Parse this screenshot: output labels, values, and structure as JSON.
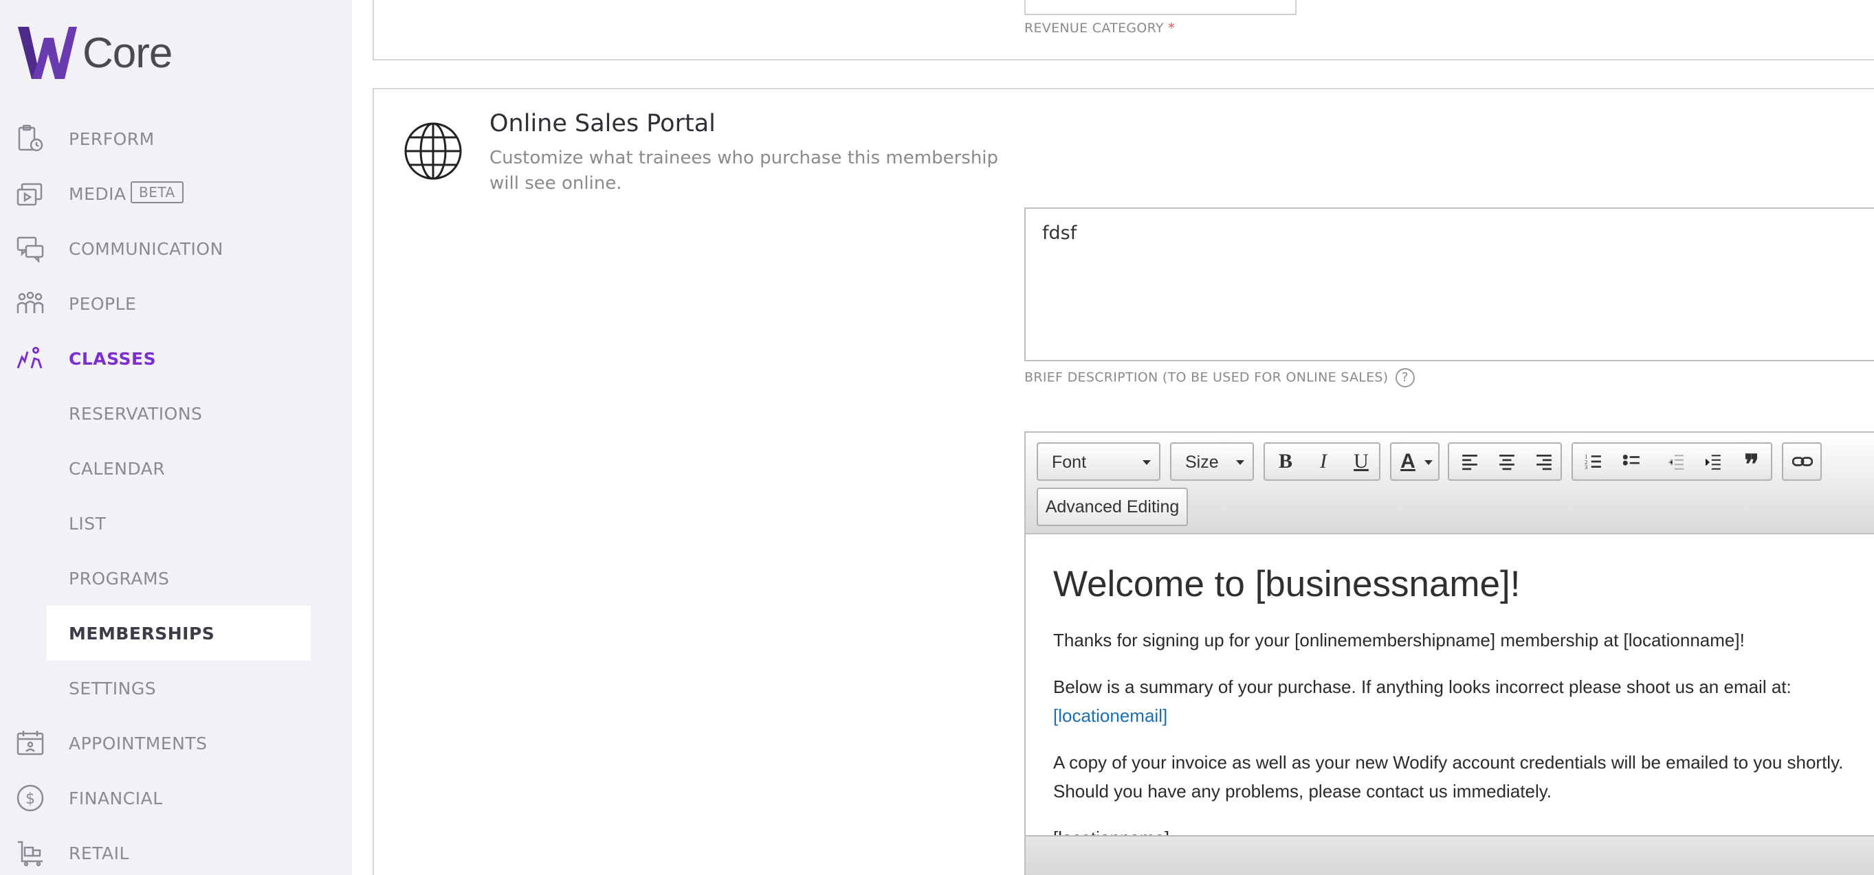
{
  "app": {
    "logo_text": "Core",
    "accent": "#7b2fd1"
  },
  "sidebar": {
    "items": [
      {
        "label": "PERFORM",
        "icon": "perform-icon"
      },
      {
        "label": "MEDIA",
        "icon": "media-icon",
        "badge": "BETA"
      },
      {
        "label": "COMMUNICATION",
        "icon": "communication-icon"
      },
      {
        "label": "PEOPLE",
        "icon": "people-icon"
      },
      {
        "label": "CLASSES",
        "icon": "classes-icon",
        "active": true
      },
      {
        "label": "APPOINTMENTS",
        "icon": "appointments-icon"
      },
      {
        "label": "FINANCIAL",
        "icon": "financial-icon"
      },
      {
        "label": "RETAIL",
        "icon": "retail-icon"
      }
    ],
    "sub_items": [
      {
        "label": "RESERVATIONS"
      },
      {
        "label": "CALENDAR"
      },
      {
        "label": "LIST"
      },
      {
        "label": "PROGRAMS"
      },
      {
        "label": "MEMBERSHIPS",
        "selected": true
      },
      {
        "label": "SETTINGS"
      }
    ]
  },
  "revenue": {
    "label": "REVENUE CATEGORY",
    "required_mark": "*"
  },
  "portal": {
    "title": "Online Sales Portal",
    "description": "Customize what trainees who purchase this membership will see online.",
    "brief_description_value": "fdsf",
    "brief_description_label": "BRIEF DESCRIPTION (TO BE USED FOR ONLINE SALES)",
    "help_glyph": "?"
  },
  "editor": {
    "font_label": "Font",
    "size_label": "Size",
    "bold": "B",
    "italic": "I",
    "underline": "U",
    "color": "A",
    "quote": "❞",
    "advanced_label": "Advanced Editing",
    "content": {
      "heading": "Welcome to [businessname]!",
      "p1": "Thanks for signing up for your [onlinemembershipname] membership at [locationname]!",
      "p2": "Below is a summary of your purchase. If anything looks incorrect please shoot us an email at:",
      "p2_link": "[locationemail]",
      "p3": "A copy of your invoice as well as your new Wodify account credentials will be emailed to you shortly. Should you have any problems, please contact us immediately.",
      "p4": "[locationname]"
    }
  }
}
